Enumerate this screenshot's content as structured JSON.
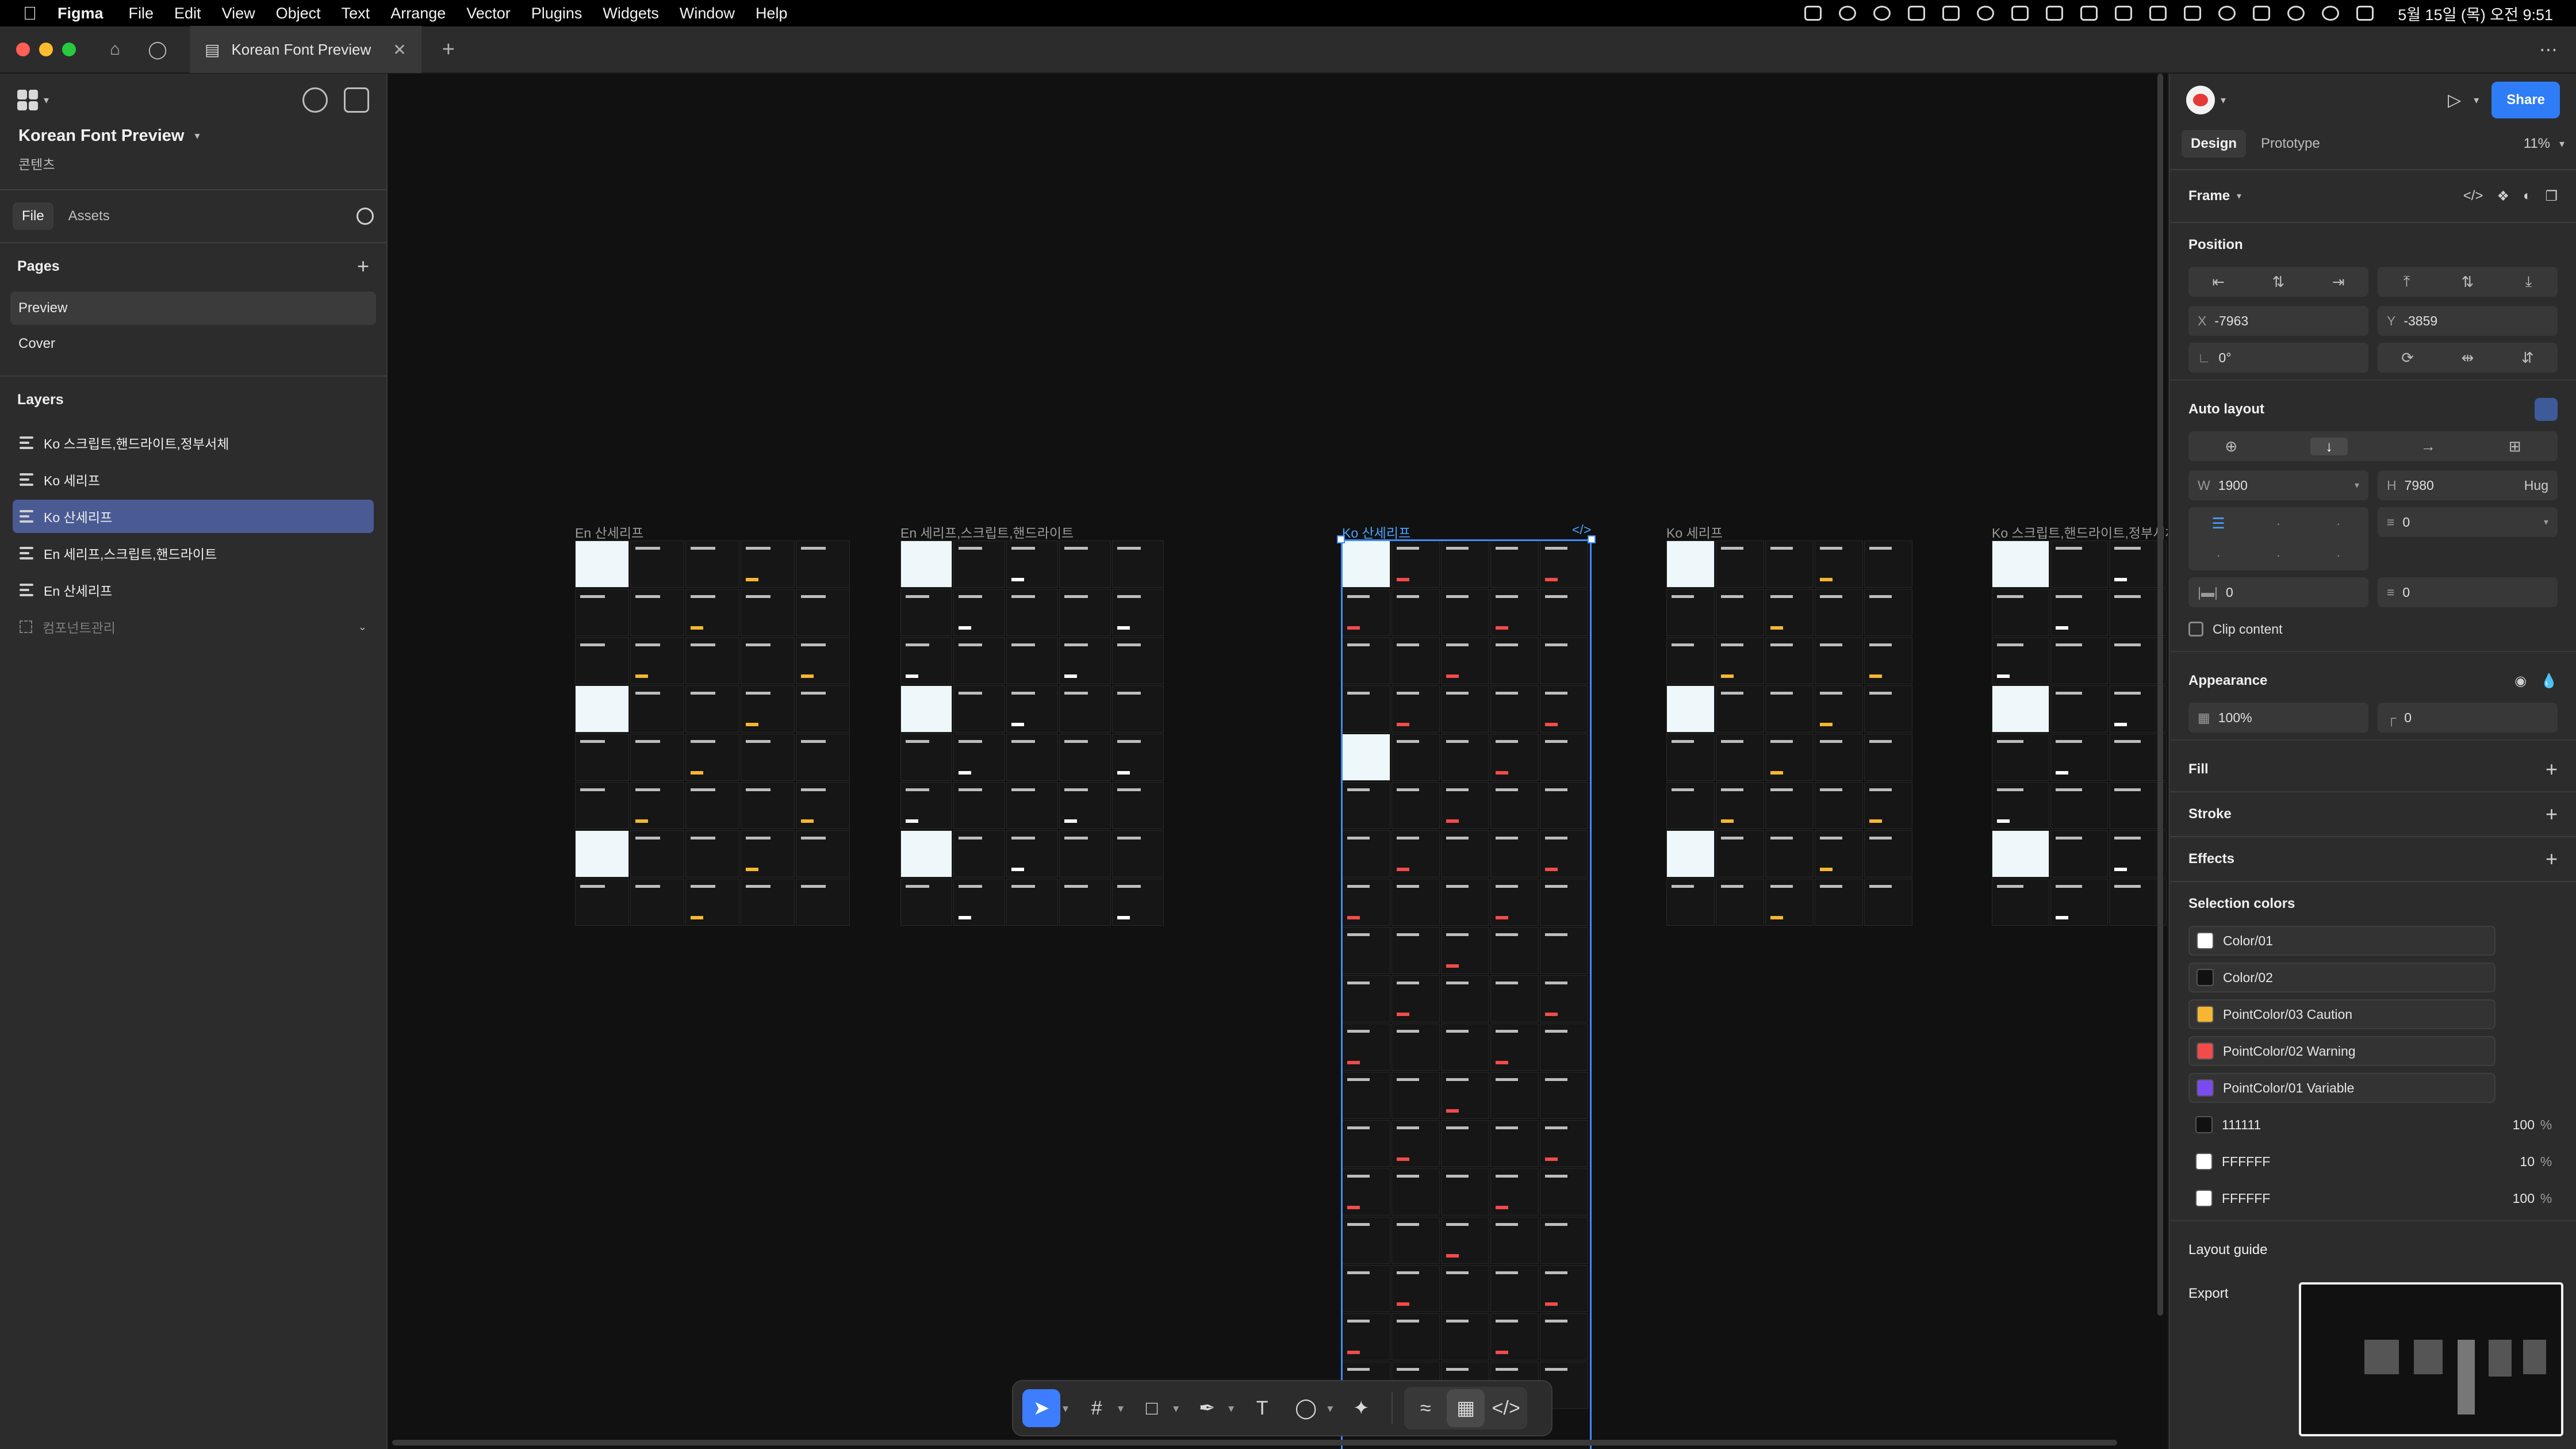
{
  "menubar": {
    "app": "Figma",
    "items": [
      "File",
      "Edit",
      "View",
      "Object",
      "Vector",
      "Text",
      "Arrange",
      "Vector",
      "Plugins",
      "Widgets",
      "Window",
      "Help"
    ],
    "clock": "5월 15일 (목) 오전 9:51"
  },
  "tabbar": {
    "doc_tab": "Korean Font Preview",
    "colors": {
      "close": "#ff5f57",
      "minimize": "#febc2e",
      "zoom": "#28c840"
    }
  },
  "left": {
    "project_title": "Korean Font Preview",
    "project_sub": "콘텐츠",
    "tabs": [
      "File",
      "Assets"
    ],
    "pages_title": "Pages",
    "pages": [
      "Preview",
      "Cover"
    ],
    "layers_title": "Layers",
    "layers": [
      "Ko 스크립트,핸드라이트,정부서체",
      "Ko 세리프",
      "Ko 산세리프",
      "En 세리프,스크립트,핸드라이트",
      "En 산세리프",
      "컴포넌트관리"
    ]
  },
  "canvas": {
    "frames": [
      {
        "label": "En 산세리프"
      },
      {
        "label": "En 세리프,스크립트,핸드라이트"
      },
      {
        "label": "Ko 산세리프"
      },
      {
        "label": "Ko 세리프"
      },
      {
        "label": "Ko 스크립트,핸드라이트,정부서체"
      }
    ],
    "code_badge": "</>"
  },
  "right": {
    "share": "Share",
    "tabs": [
      "Design",
      "Prototype"
    ],
    "zoom": "11%",
    "frame_title": "Frame",
    "position_title": "Position",
    "x_label": "X",
    "x": "-7963",
    "y_label": "Y",
    "y": "-3859",
    "rotation": "0°",
    "auto_layout_title": "Auto layout",
    "w_label": "W",
    "w": "1900",
    "h_label": "H",
    "h": "7980",
    "h_mode": "Hug",
    "gap": "0",
    "padding_h": "0",
    "padding_v": "0",
    "clip_content": "Clip content",
    "appearance_title": "Appearance",
    "opacity": "100%",
    "radius": "0",
    "fill_title": "Fill",
    "stroke_title": "Stroke",
    "effects_title": "Effects",
    "selection_colors_title": "Selection colors",
    "selection_colors": [
      {
        "name": "Color/01",
        "color": "#ffffff"
      },
      {
        "name": "Color/02",
        "color": "#111111"
      },
      {
        "name": "PointColor/03 Caution",
        "color": "#f5b731"
      },
      {
        "name": "PointColor/02 Warning",
        "color": "#f24b4b"
      },
      {
        "name": "PointColor/01 Variable",
        "color": "#7b4bf2"
      }
    ],
    "hex_colors": [
      {
        "hex": "111111",
        "pct": "100",
        "color": "#111111"
      },
      {
        "hex": "FFFFFF",
        "pct": "10",
        "color": "#ffffff"
      },
      {
        "hex": "FFFFFF",
        "pct": "100",
        "color": "#ffffff"
      }
    ],
    "percent_sign": "%",
    "layout_guide": "Layout guide",
    "export": "Export"
  }
}
